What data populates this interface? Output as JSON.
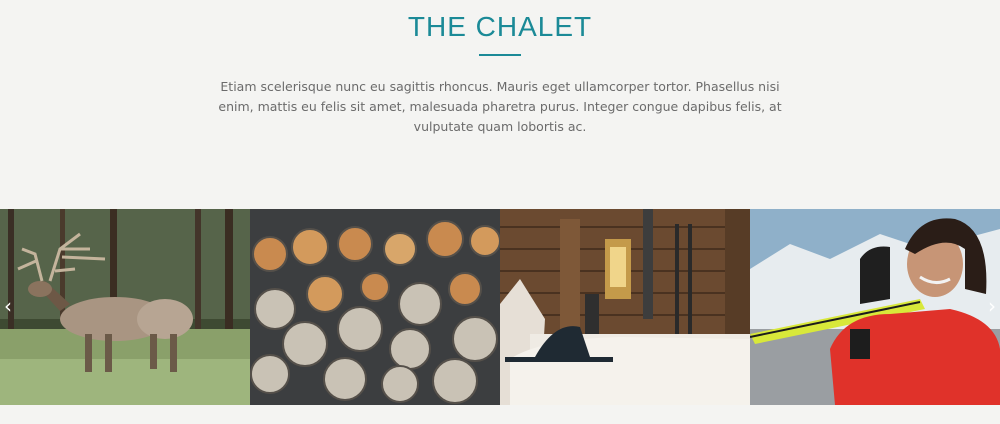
{
  "section": {
    "title": "THE CHALET",
    "body": "Etiam scelerisque nunc eu sagittis rhoncus. Mauris eget ullamcorper tortor. Phasellus nisi enim, mattis eu felis sit amet, malesuada pharetra purus. Integer congue dapibus felis, at vulputate quam lobortis ac."
  },
  "gallery": {
    "prev_icon": "chevron-left-icon",
    "next_icon": "chevron-right-icon",
    "prev_glyph": "‹",
    "next_glyph": "›",
    "images": [
      {
        "subject": "elk-in-forest"
      },
      {
        "subject": "stacked-firewood-logs"
      },
      {
        "subject": "wooden-chalet-interior-lantern"
      },
      {
        "subject": "woman-carrying-skis"
      }
    ]
  },
  "colors": {
    "accent": "#1b8a97",
    "background": "#f4f4f2",
    "text": "#6b6b6b"
  }
}
